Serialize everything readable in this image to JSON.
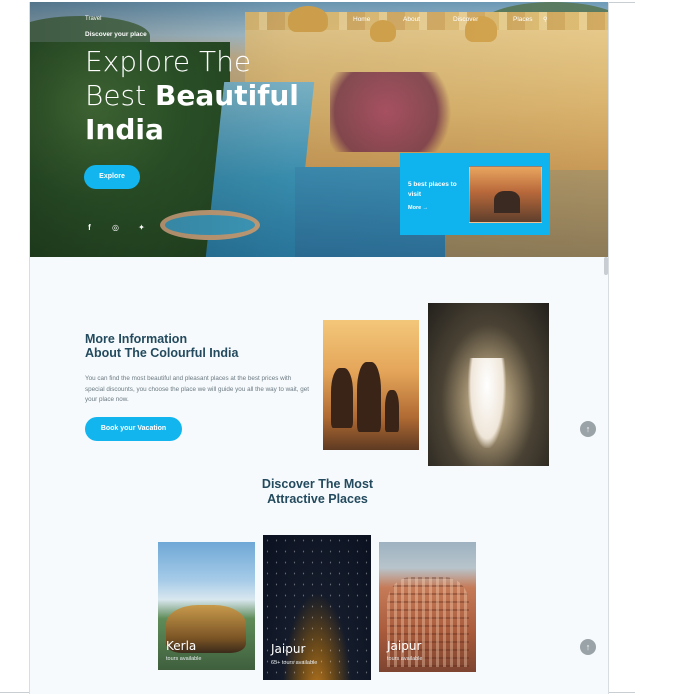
{
  "header": {
    "brand": "Travel",
    "nav": [
      "Home",
      "About",
      "Discover",
      "Places"
    ],
    "tagline": "Discover your place",
    "headline_line1": "Explore The",
    "headline_line2_light": "Best",
    "headline_line2_bold": "Beautiful",
    "headline_line3": "India",
    "explore_label": "Explore",
    "socials": [
      "facebook-icon",
      "instagram-icon",
      "twitter-icon"
    ]
  },
  "promo_card": {
    "title": "5 best places to visit",
    "more_label": "More",
    "accent": "#13b5ef"
  },
  "about": {
    "title_line1": "More Information",
    "title_line2": "About The Colourful India",
    "text": "You can find the most beautiful and pleasant places at the best prices with special discounts, you choose the place we will guide you all the way to wait, get your place now.",
    "button_label": "Book your Vacation"
  },
  "discover": {
    "title_line1": "Discover The Most",
    "title_line2": "Attractive Places",
    "places": [
      {
        "name": "Kerla",
        "tours": "tours available"
      },
      {
        "name": "Jaipur",
        "tours": "65+ tours available"
      },
      {
        "name": "Jaipur",
        "tours": "tours available"
      }
    ]
  },
  "colors": {
    "accent": "#13b5ef",
    "heading": "#234a5e",
    "body_text": "#6b7a83"
  }
}
